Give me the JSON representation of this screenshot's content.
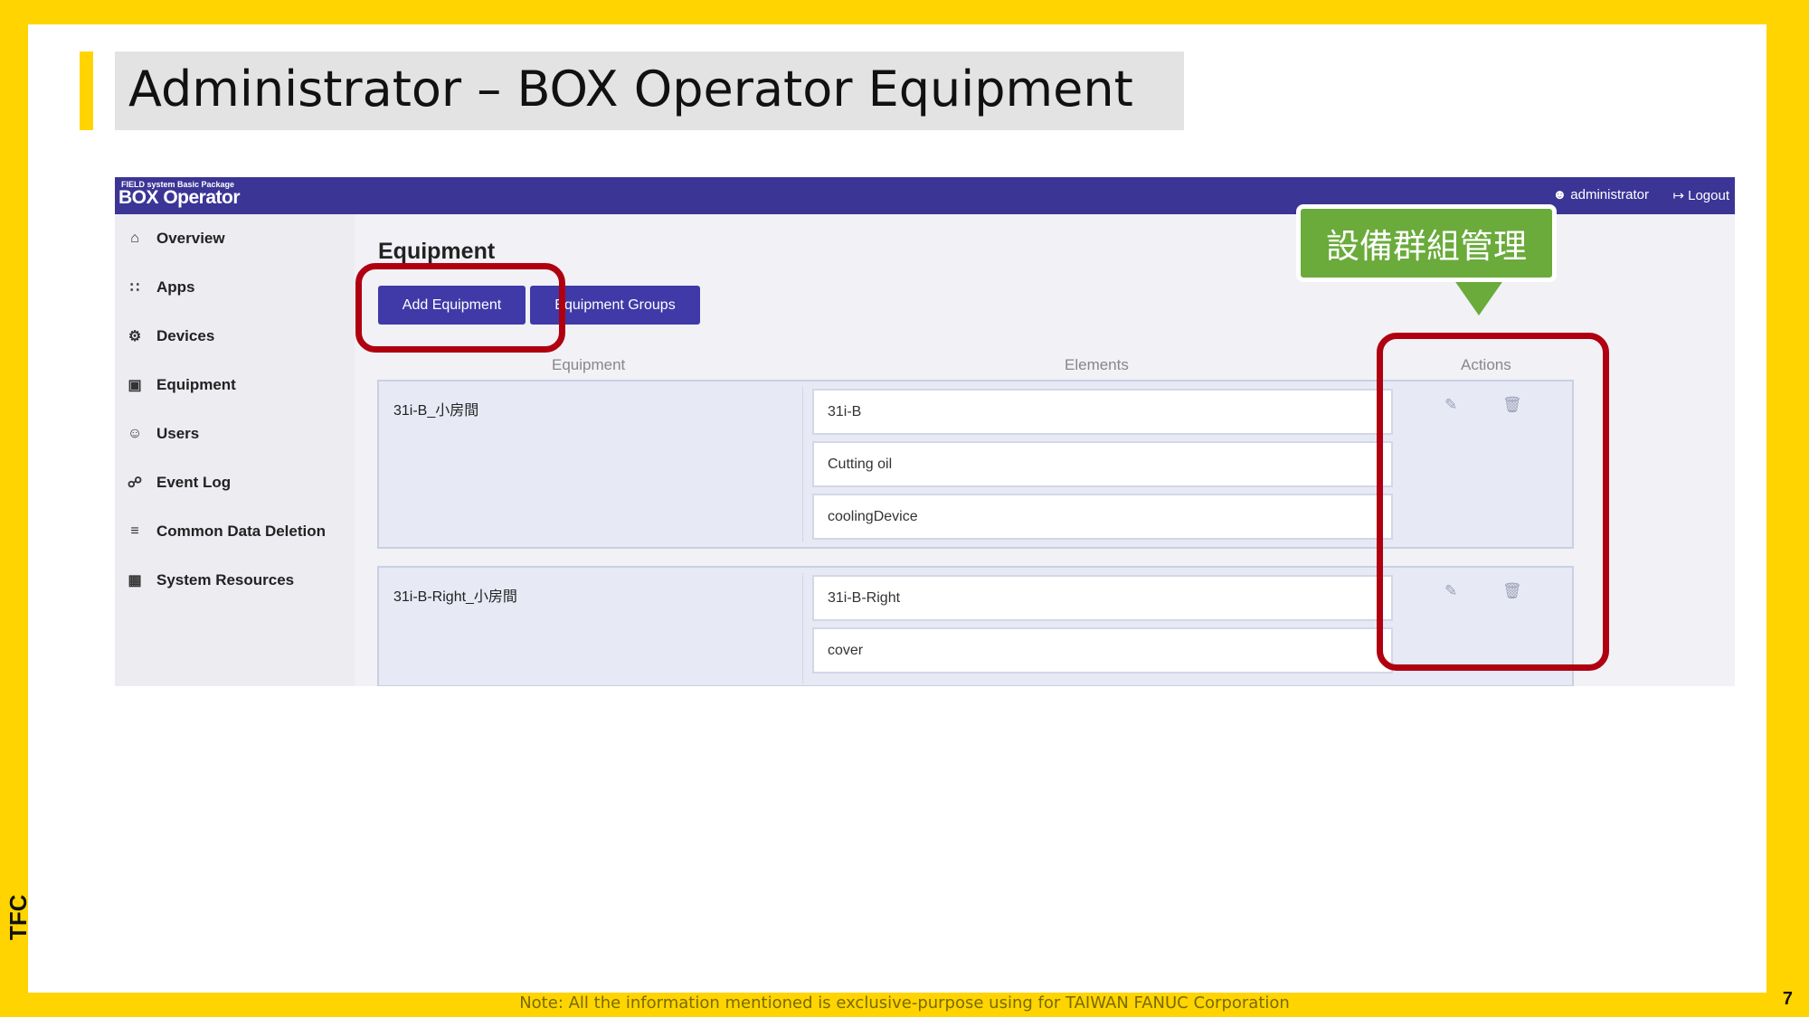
{
  "slide": {
    "title": "Administrator – BOX Operator Equipment",
    "footer_note": "Note: All the information mentioned is exclusive-purpose using for TAIWAN FANUC Corporation",
    "page_number": "7",
    "logo_text": "TFC"
  },
  "app": {
    "brand_small": "FIELD system Basic Package",
    "brand_big": "BOX Operator",
    "user_label": "administrator",
    "logout_label": "Logout",
    "sidebar": [
      {
        "label": "Overview",
        "icon": "home-icon"
      },
      {
        "label": "Apps",
        "icon": "grid-icon"
      },
      {
        "label": "Devices",
        "icon": "robot-arm-icon"
      },
      {
        "label": "Equipment",
        "icon": "machine-icon"
      },
      {
        "label": "Users",
        "icon": "users-icon"
      },
      {
        "label": "Event Log",
        "icon": "event-log-icon"
      },
      {
        "label": "Common Data Deletion",
        "icon": "list-delete-icon"
      },
      {
        "label": "System Resources",
        "icon": "chip-icon"
      }
    ],
    "page_heading": "Equipment",
    "buttons": {
      "add_equipment": "Add Equipment",
      "equipment_groups": "Equipment Groups"
    },
    "columns": {
      "equipment": "Equipment",
      "elements": "Elements",
      "actions": "Actions"
    },
    "rows": [
      {
        "name": "31i-B_小房間",
        "elements": [
          "31i-B",
          "Cutting oil",
          "coolingDevice"
        ]
      },
      {
        "name": "31i-B-Right_小房間",
        "elements": [
          "31i-B-Right",
          "cover"
        ]
      }
    ]
  },
  "annotation": {
    "callout_text": "設備群組管理",
    "callout_color": "#6aab3b",
    "highlight_color": "#b00010"
  }
}
